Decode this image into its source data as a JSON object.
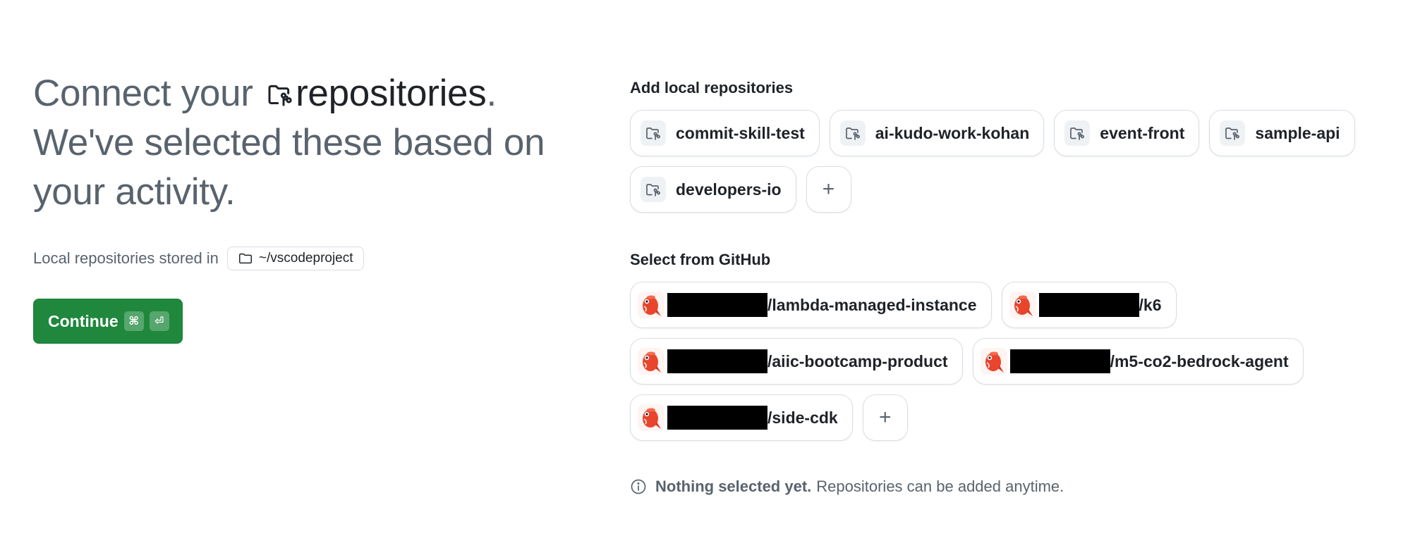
{
  "headline": {
    "part1": "Connect your",
    "repo_word": "repositories",
    "period": ".",
    "line2": "We've selected these based on",
    "line3": "your activity."
  },
  "storage": {
    "label": "Local repositories stored in",
    "path": "~/vscodeproject",
    "folder_icon": "folder-icon"
  },
  "continue_button": {
    "label": "Continue",
    "shortcut_cmd": "⌘",
    "shortcut_enter": "⏎"
  },
  "local_section": {
    "title": "Add local repositories",
    "repos": [
      {
        "name": "commit-skill-test",
        "icon": "repo-folder-icon"
      },
      {
        "name": "ai-kudo-work-kohan",
        "icon": "repo-folder-icon"
      },
      {
        "name": "event-front",
        "icon": "repo-folder-icon"
      },
      {
        "name": "sample-api",
        "icon": "repo-folder-icon"
      },
      {
        "name": "developers-io",
        "icon": "repo-folder-icon"
      }
    ],
    "add_label": "+"
  },
  "github_section": {
    "title": "Select from GitHub",
    "repos": [
      {
        "suffix": "/lambda-managed-instance",
        "owner_redacted": true
      },
      {
        "suffix": "/k6",
        "owner_redacted": true
      },
      {
        "suffix": "/aiic-bootcamp-product",
        "owner_redacted": true
      },
      {
        "suffix": "/m5-co2-bedrock-agent",
        "owner_redacted": true
      },
      {
        "suffix": "/side-cdk",
        "owner_redacted": true
      }
    ],
    "add_label": "+"
  },
  "notice": {
    "bold": "Nothing selected yet.",
    "text": "Repositories can be added anytime.",
    "icon": "info-icon"
  },
  "colors": {
    "accent_green": "#1f883d",
    "muted_text": "#59636e",
    "border": "#d8dee4"
  }
}
